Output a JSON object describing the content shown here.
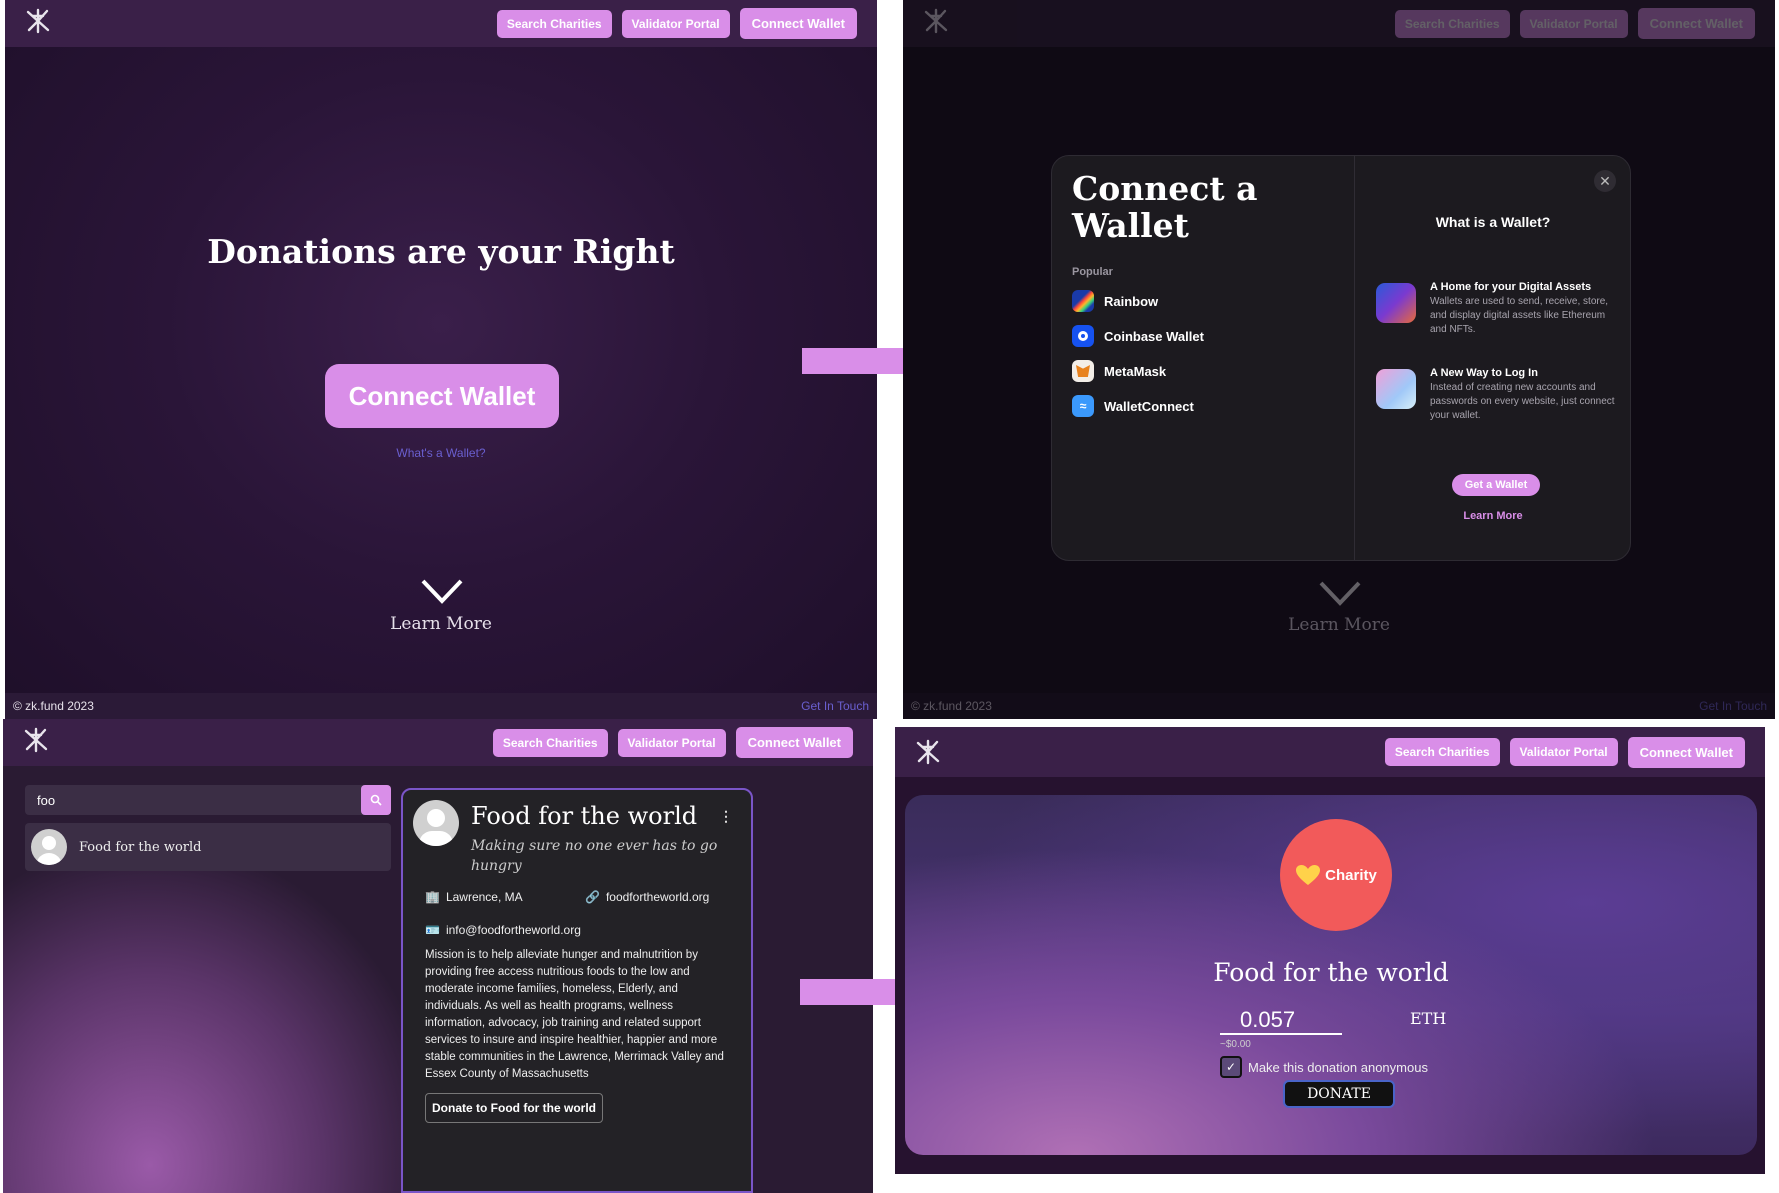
{
  "nav": {
    "search_label": "Search Charities",
    "validator_label": "Validator Portal",
    "connect_label": "Connect Wallet"
  },
  "landing": {
    "headline": "Donations are your Right",
    "cta_label": "Connect Wallet",
    "whats_wallet": "What's a Wallet?",
    "learn_more": "Learn More"
  },
  "footer": {
    "copyright": "© zk.fund 2023",
    "contact": "Get In Touch"
  },
  "modal": {
    "title": "Connect a Wallet",
    "section_label": "Popular",
    "wallets": [
      {
        "name": "Rainbow",
        "icon": "rainbow-icon"
      },
      {
        "name": "Coinbase Wallet",
        "icon": "coinbase-icon"
      },
      {
        "name": "MetaMask",
        "icon": "metamask-icon"
      },
      {
        "name": "WalletConnect",
        "icon": "walletconnect-icon"
      }
    ],
    "close_icon": "close-icon",
    "info_title": "What is a Wallet?",
    "features": [
      {
        "heading": "A Home for your Digital Assets",
        "text": "Wallets are used to send, receive, store, and display digital assets like Ethereum and NFTs."
      },
      {
        "heading": "A New Way to Log In",
        "text": "Instead of creating new accounts and passwords on every website, just connect your wallet."
      }
    ],
    "get_wallet": "Get a Wallet",
    "learn_more": "Learn More"
  },
  "search": {
    "query": "foo",
    "result_name": "Food for the world"
  },
  "charity": {
    "name": "Food for the world",
    "tagline": "Making sure no one ever has to go hungry",
    "location": "Lawrence, MA",
    "website": "foodfortheworld.org",
    "email": "info@foodfortheworld.org",
    "mission": "Mission is to help alleviate hunger and malnutrition by providing free access nutritious foods to the low and moderate income families, homeless, Elderly, and individuals. As well as health programs, wellness information, advocacy, job training and related support services to insure and inspire healthier, happier and more stable communities in the Lawrence, Merrimack Valley and Essex County of Massachusetts",
    "donate_label": "Donate to Food for the world"
  },
  "donate": {
    "badge_label": "Charity",
    "name": "Food for the world",
    "amount": "0.057",
    "currency": "ETH",
    "usd": "~$0.00",
    "anonymous_label": "Make this donation anonymous",
    "anonymous_checked": true,
    "button_label": "DONATE"
  },
  "colors": {
    "accent": "#d98ee8",
    "nav_bg": "#3a2048",
    "link": "#6a5fcf",
    "badge": "#f25a5a",
    "arrow": "#d98ee8"
  }
}
